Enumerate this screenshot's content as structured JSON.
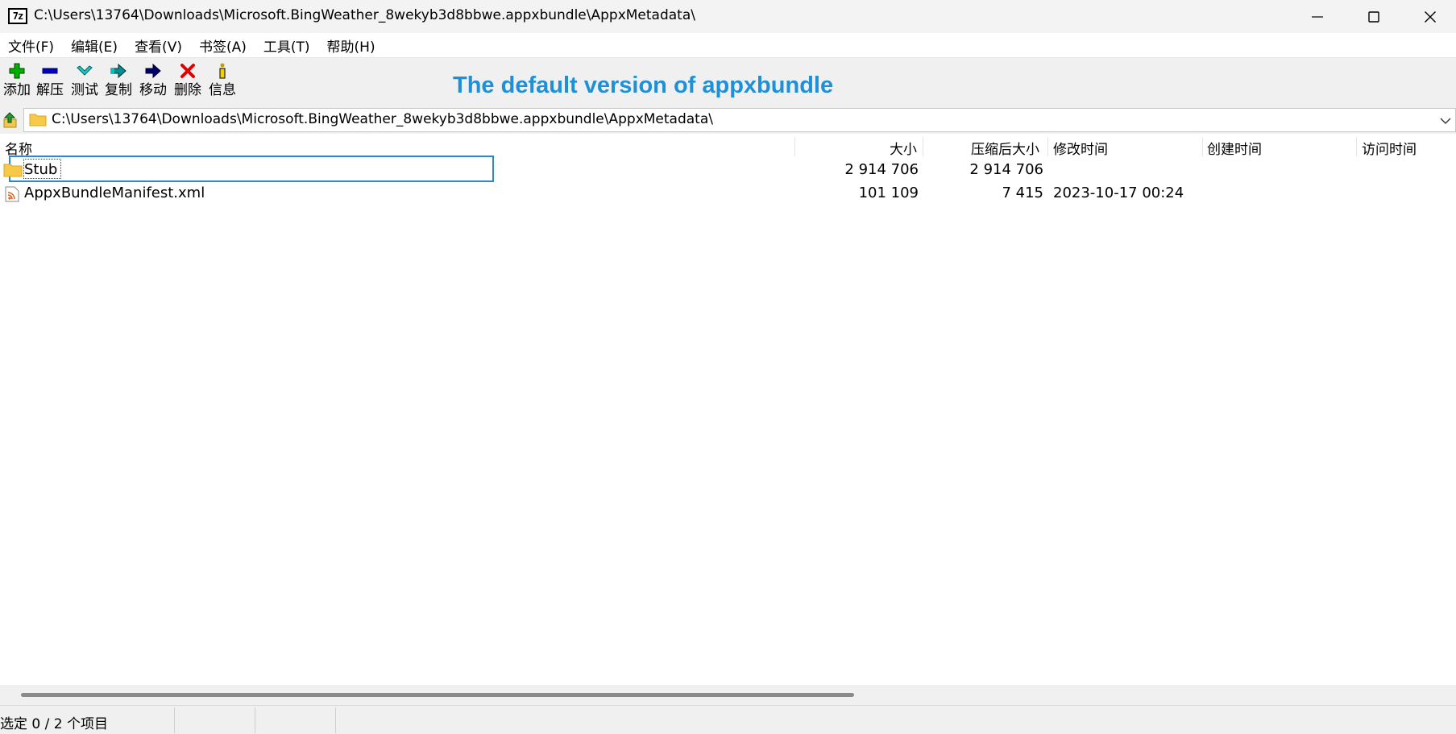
{
  "window": {
    "title": "C:\\Users\\13764\\Downloads\\Microsoft.BingWeather_8wekyb3d8bbwe.appxbundle\\AppxMetadata\\",
    "app_icon_text": "7z"
  },
  "menu": [
    "文件(F)",
    "编辑(E)",
    "查看(V)",
    "书签(A)",
    "工具(T)",
    "帮助(H)"
  ],
  "toolbar": {
    "buttons": [
      {
        "label": "添加",
        "icon": "add-icon",
        "color": "#00a000"
      },
      {
        "label": "解压",
        "icon": "extract-icon",
        "color": "#0000b0"
      },
      {
        "label": "测试",
        "icon": "test-icon",
        "color": "#00b0b0"
      },
      {
        "label": "复制",
        "icon": "copy-icon",
        "color": "#008080"
      },
      {
        "label": "移动",
        "icon": "move-icon",
        "color": "#00006a"
      },
      {
        "label": "删除",
        "icon": "delete-icon",
        "color": "#e00000"
      },
      {
        "label": "信息",
        "icon": "info-icon",
        "color": "#c0a000"
      }
    ],
    "banner_text": "The default version of appxbundle",
    "banner_color": "#1e90d8"
  },
  "address": {
    "path": "C:\\Users\\13764\\Downloads\\Microsoft.BingWeather_8wekyb3d8bbwe.appxbundle\\AppxMetadata\\"
  },
  "columns": [
    "名称",
    "大小",
    "压缩后大小",
    "修改时间",
    "创建时间",
    "访问时间"
  ],
  "files": [
    {
      "name": "Stub",
      "type": "folder",
      "size": "2 914 706",
      "packed": "2 914 706",
      "modified": "",
      "created": "",
      "accessed": ""
    },
    {
      "name": "AppxBundleManifest.xml",
      "type": "xml-file",
      "size": "101 109",
      "packed": "7 415",
      "modified": "2023-10-17 00:24",
      "created": "",
      "accessed": ""
    }
  ],
  "status": {
    "text": "选定 0 / 2 个项目"
  }
}
